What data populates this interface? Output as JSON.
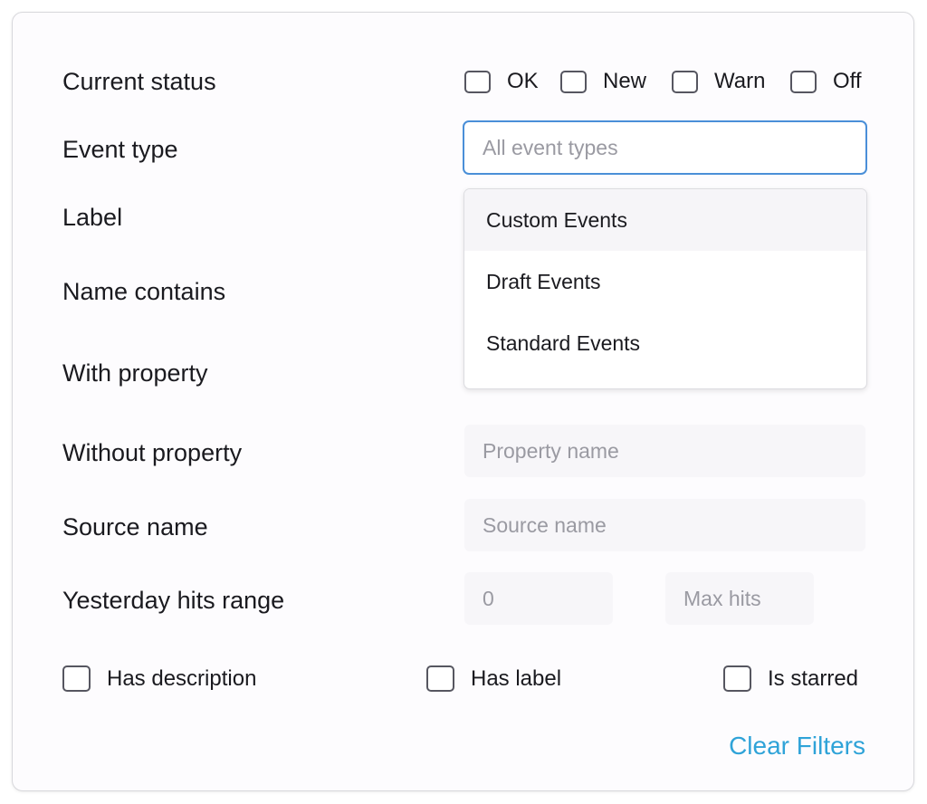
{
  "filters": {
    "current_status": {
      "label": "Current status",
      "options": [
        "OK",
        "New",
        "Warn",
        "Off"
      ]
    },
    "event_type": {
      "label": "Event type",
      "placeholder": "All event types",
      "dropdown_options": [
        "Custom Events",
        "Draft Events",
        "Standard Events"
      ]
    },
    "label_filter": {
      "label": "Label"
    },
    "name_contains": {
      "label": "Name contains"
    },
    "with_property": {
      "label": "With property"
    },
    "without_property": {
      "label": "Without property",
      "placeholder": "Property name"
    },
    "source_name": {
      "label": "Source name",
      "placeholder": "Source name"
    },
    "yesterday_hits": {
      "label": "Yesterday hits range",
      "min_placeholder": "0",
      "max_placeholder": "Max hits"
    },
    "toggles": [
      "Has description",
      "Has label",
      "Is starred"
    ],
    "clear_label": "Clear Filters"
  },
  "colors": {
    "accent": "#2fa3d8",
    "focus_border": "#4a8fd8"
  }
}
